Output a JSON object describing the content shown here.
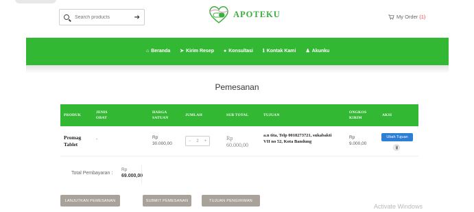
{
  "header": {
    "search_placeholder": "Search products",
    "brand_name": "APOTEKU",
    "my_order_label": "My Order",
    "my_order_count": "(1)"
  },
  "nav": {
    "items": [
      {
        "label": "Beranda",
        "icon": "home-icon"
      },
      {
        "label": "Kirim Resep",
        "icon": "send-icon"
      },
      {
        "label": "Konsultasi",
        "icon": "chat-icon"
      },
      {
        "label": "Kontak Kami",
        "icon": "info-icon"
      },
      {
        "label": "Akunku",
        "icon": "user-icon"
      }
    ]
  },
  "page": {
    "title": "Pemesanan"
  },
  "table": {
    "headers": [
      "PRODUK",
      "JENIS OBAT",
      "HARGA SATUAN",
      "JUMLAH",
      "SUB TOTAL",
      "TUJUAN",
      "ONGKOS KIRIM",
      "AKSI"
    ],
    "row": {
      "produk": "Promag Tablet",
      "jenis": "-",
      "harga_rp": "Rp",
      "harga_val": "30.000,00",
      "qty_minus": "−",
      "qty_value": "2",
      "qty_plus": "+",
      "sub_rp": "Rp",
      "sub_val": "60.000,00",
      "tujuan": "a.n tita, Telp 0018273721, sukabakti VII no 52, Kota Bandung",
      "ongkos_rp": "Rp",
      "ongkos_val": "9.000,00",
      "ubah_label": "Ubah Tujuan"
    }
  },
  "total": {
    "label": "Total Pembayaran :",
    "rp": "Rp",
    "value": "69.000,00"
  },
  "actions": {
    "lanjutkan": "LANJUTKAN PEMESANAN",
    "submit": "SUBMIT PEMESANAN",
    "tujuan": "TUJUAN PENGIRIMAN"
  },
  "watermark": "Activate Windows",
  "colors": {
    "brand_green": "#33b833",
    "button_blue": "#2d7fd6",
    "button_grey": "#a8a29b"
  }
}
